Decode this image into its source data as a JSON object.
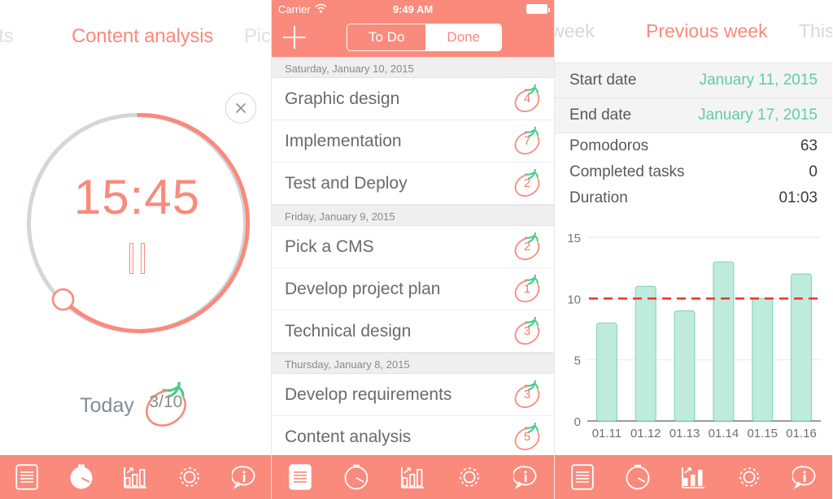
{
  "colors": {
    "coral": "#FA8A7C",
    "coral_strong": "#F4766A",
    "mint": "#BFEBDC",
    "mint_border": "#7FD7B8",
    "green": "#5FCFA0",
    "leaf_green": "#4CC98A",
    "gray_text": "#6a6a6a",
    "dashed_red": "#F23A2E"
  },
  "timer_screen": {
    "carousel": {
      "prev_task": "ents",
      "current_task": "Content analysis",
      "next_task": "Pick"
    },
    "close_icon": "close-icon",
    "time_remaining": "15:45",
    "progress_percent": 62,
    "pause_icon": "pause-icon",
    "today_label": "Today",
    "today_count": "3/10",
    "tabbar": {
      "items": [
        {
          "icon": "list-icon",
          "label": "Tasks",
          "selected": false
        },
        {
          "icon": "timer-icon",
          "label": "Timer",
          "selected": true
        },
        {
          "icon": "chart-icon",
          "label": "Statistics",
          "selected": false
        },
        {
          "icon": "gear-icon",
          "label": "Settings",
          "selected": false
        },
        {
          "icon": "info-icon",
          "label": "Info",
          "selected": false
        }
      ]
    }
  },
  "tasks_screen": {
    "statusbar": {
      "carrier": "Carrier",
      "wifi_icon": "wifi-icon",
      "time": "9:49 AM",
      "battery_icon": "battery-icon"
    },
    "navbar": {
      "add_icon": "plus-icon",
      "segments": [
        {
          "label": "To Do",
          "selected": true
        },
        {
          "label": "Done",
          "selected": false
        }
      ]
    },
    "sections": [
      {
        "date": "Saturday, January 10, 2015",
        "tasks": [
          {
            "title": "Graphic design",
            "pomodoros": "4"
          },
          {
            "title": "Implementation",
            "pomodoros": "7"
          },
          {
            "title": "Test and Deploy",
            "pomodoros": "2"
          }
        ]
      },
      {
        "date": "Friday, January 9, 2015",
        "tasks": [
          {
            "title": "Pick a CMS",
            "pomodoros": "2"
          },
          {
            "title": "Develop project plan",
            "pomodoros": "1"
          },
          {
            "title": "Technical design",
            "pomodoros": "3"
          }
        ]
      },
      {
        "date": "Thursday, January 8, 2015",
        "tasks": [
          {
            "title": "Develop requirements",
            "pomodoros": "3"
          },
          {
            "title": "Content analysis",
            "pomodoros": "5"
          }
        ]
      }
    ],
    "tabbar": {
      "items": [
        {
          "icon": "list-icon",
          "label": "Tasks",
          "selected": true
        },
        {
          "icon": "timer-icon",
          "label": "Timer",
          "selected": false
        },
        {
          "icon": "chart-icon",
          "label": "Statistics",
          "selected": false
        },
        {
          "icon": "gear-icon",
          "label": "Settings",
          "selected": false
        },
        {
          "icon": "info-icon",
          "label": "Info",
          "selected": false
        }
      ]
    }
  },
  "stats_screen": {
    "tabs": [
      {
        "label": "is week",
        "full": "This week",
        "active": false
      },
      {
        "label": "Previous week",
        "full": "Previous week",
        "active": true
      },
      {
        "label": "This mo",
        "full": "This month",
        "active": false
      }
    ],
    "date_rows": [
      {
        "label": "Start date",
        "value": "January 11, 2015"
      },
      {
        "label": "End date",
        "value": "January 17, 2015"
      }
    ],
    "metric_rows": [
      {
        "label": "Pomodoros",
        "value": "63"
      },
      {
        "label": "Completed tasks",
        "value": "0"
      },
      {
        "label": "Duration",
        "value": "01:03"
      }
    ],
    "tabbar": {
      "items": [
        {
          "icon": "list-icon",
          "label": "Tasks",
          "selected": false
        },
        {
          "icon": "timer-icon",
          "label": "Timer",
          "selected": false
        },
        {
          "icon": "chart-icon",
          "label": "Statistics",
          "selected": true
        },
        {
          "icon": "gear-icon",
          "label": "Settings",
          "selected": false
        },
        {
          "icon": "info-icon",
          "label": "Info",
          "selected": false
        }
      ]
    }
  },
  "chart_data": {
    "type": "bar",
    "title": "",
    "xlabel": "",
    "ylabel": "",
    "categories": [
      "01.11",
      "01.12",
      "01.13",
      "01.14",
      "01.15",
      "01.16"
    ],
    "values": [
      8,
      11,
      9,
      13,
      10,
      12
    ],
    "ylim": [
      0,
      15
    ],
    "yticks": [
      0,
      5,
      10,
      15
    ],
    "ytick_labels": [
      "0",
      "5",
      "10",
      "15"
    ],
    "grid": true,
    "legend": "none",
    "target_line": {
      "value": 10,
      "style": "dashed",
      "color": "#F23A2E"
    },
    "bar_color": "#BFEBDC",
    "bar_border": "#7FD7B8"
  }
}
